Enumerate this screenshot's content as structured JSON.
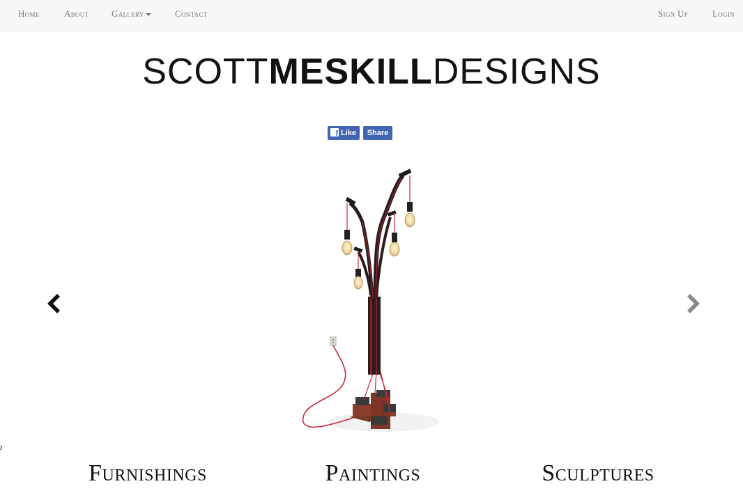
{
  "navbar": {
    "left_items": [
      {
        "label": "Home"
      },
      {
        "label": "About"
      },
      {
        "label": "Gallery"
      },
      {
        "label": "Contact"
      }
    ],
    "right_items": [
      {
        "label": "Sign Up"
      },
      {
        "label": "Login"
      }
    ]
  },
  "logo": {
    "part1": "SCOTT",
    "part2": "MESKILL",
    "part3": "DESIGNS"
  },
  "social": {
    "like_label": "Like",
    "share_label": "Share",
    "brand_color": "#4267b2"
  },
  "carousel": {
    "image_subject": "tree-shaped floor lamp with hanging edison bulbs and red cords on wooden cross base",
    "prev_icon": "chevron-left-icon",
    "next_icon": "chevron-right-icon"
  },
  "categories": [
    {
      "label": "Furnishings"
    },
    {
      "label": "Paintings"
    },
    {
      "label": "Sculptures"
    }
  ]
}
